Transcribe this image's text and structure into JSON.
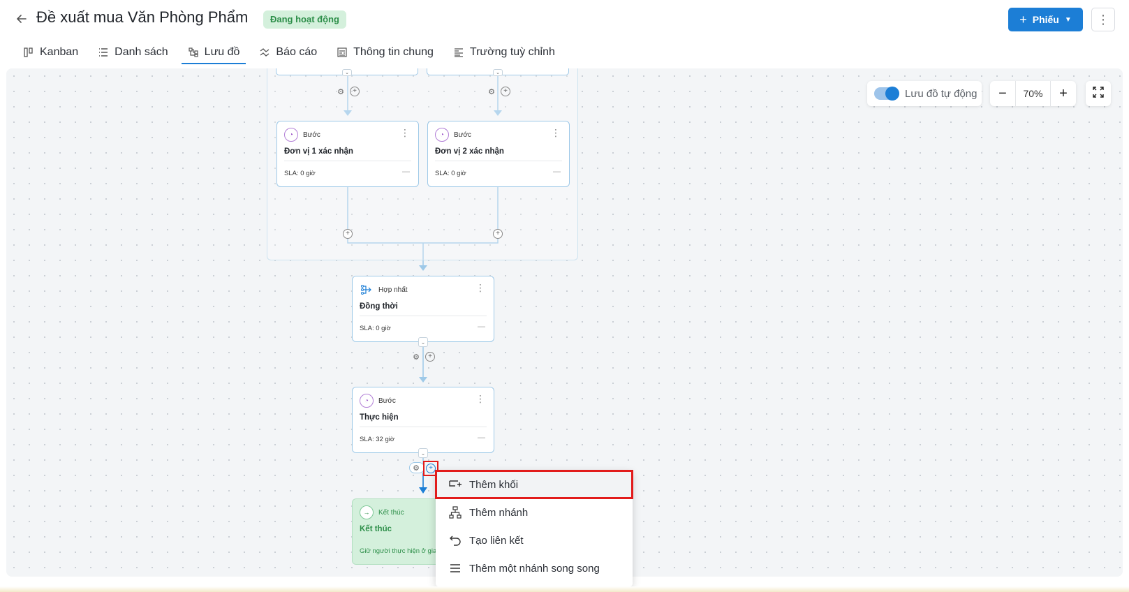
{
  "header": {
    "title": "Đề xuất mua Văn Phòng Phẩm",
    "status": "Đang hoạt động",
    "primary_button": "Phiếu"
  },
  "tabs": [
    {
      "label": "Kanban",
      "icon": "kanban-icon"
    },
    {
      "label": "Danh sách",
      "icon": "list-icon"
    },
    {
      "label": "Lưu đồ",
      "icon": "flowchart-icon",
      "active": true
    },
    {
      "label": "Báo cáo",
      "icon": "report-icon"
    },
    {
      "label": "Thông tin chung",
      "icon": "info-icon"
    },
    {
      "label": "Trường tuỳ chỉnh",
      "icon": "custom-fields-icon"
    }
  ],
  "toolbar": {
    "auto_flow_label": "Lưu đồ tự động",
    "auto_flow_on": true,
    "zoom": "70%"
  },
  "nodes": {
    "step1": {
      "type": "Bước",
      "name": "Đơn vị 1 xác nhận",
      "sla": "SLA: 0 giờ"
    },
    "step2": {
      "type": "Bước",
      "name": "Đơn vị 2 xác nhận",
      "sla": "SLA: 0 giờ"
    },
    "merge": {
      "type": "Hợp nhất",
      "name": "Đồng thời",
      "sla": "SLA: 0 giờ"
    },
    "exec": {
      "type": "Bước",
      "name": "Thực hiện",
      "sla": "SLA: 32 giờ"
    },
    "end": {
      "type": "Kết thúc",
      "name": "Kết thúc",
      "desc": "Giữ người thực hiện ở giai"
    }
  },
  "menu": {
    "items": [
      {
        "label": "Thêm khối",
        "icon": "add-block-icon",
        "highlighted": true
      },
      {
        "label": "Thêm nhánh",
        "icon": "branch-icon"
      },
      {
        "label": "Tạo liên kết",
        "icon": "link-icon"
      },
      {
        "label": "Thêm một nhánh song song",
        "icon": "parallel-branch-icon"
      }
    ]
  },
  "colors": {
    "accent": "#1c7ed6",
    "status_bg": "#d4f0dc",
    "status_text": "#2e8f4a",
    "highlight_border": "#e21b1b"
  }
}
